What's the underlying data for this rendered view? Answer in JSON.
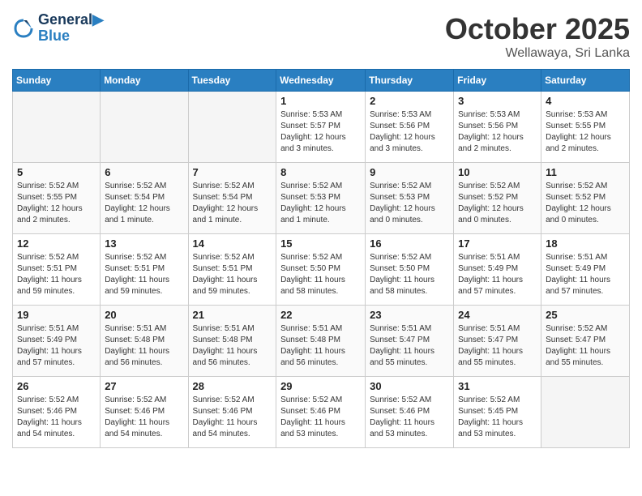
{
  "header": {
    "logo_line1": "General",
    "logo_line2": "Blue",
    "month": "October 2025",
    "location": "Wellawaya, Sri Lanka"
  },
  "weekdays": [
    "Sunday",
    "Monday",
    "Tuesday",
    "Wednesday",
    "Thursday",
    "Friday",
    "Saturday"
  ],
  "weeks": [
    [
      {
        "day": "",
        "info": ""
      },
      {
        "day": "",
        "info": ""
      },
      {
        "day": "",
        "info": ""
      },
      {
        "day": "1",
        "info": "Sunrise: 5:53 AM\nSunset: 5:57 PM\nDaylight: 12 hours and 3 minutes."
      },
      {
        "day": "2",
        "info": "Sunrise: 5:53 AM\nSunset: 5:56 PM\nDaylight: 12 hours and 3 minutes."
      },
      {
        "day": "3",
        "info": "Sunrise: 5:53 AM\nSunset: 5:56 PM\nDaylight: 12 hours and 2 minutes."
      },
      {
        "day": "4",
        "info": "Sunrise: 5:53 AM\nSunset: 5:55 PM\nDaylight: 12 hours and 2 minutes."
      }
    ],
    [
      {
        "day": "5",
        "info": "Sunrise: 5:52 AM\nSunset: 5:55 PM\nDaylight: 12 hours and 2 minutes."
      },
      {
        "day": "6",
        "info": "Sunrise: 5:52 AM\nSunset: 5:54 PM\nDaylight: 12 hours and 1 minute."
      },
      {
        "day": "7",
        "info": "Sunrise: 5:52 AM\nSunset: 5:54 PM\nDaylight: 12 hours and 1 minute."
      },
      {
        "day": "8",
        "info": "Sunrise: 5:52 AM\nSunset: 5:53 PM\nDaylight: 12 hours and 1 minute."
      },
      {
        "day": "9",
        "info": "Sunrise: 5:52 AM\nSunset: 5:53 PM\nDaylight: 12 hours and 0 minutes."
      },
      {
        "day": "10",
        "info": "Sunrise: 5:52 AM\nSunset: 5:52 PM\nDaylight: 12 hours and 0 minutes."
      },
      {
        "day": "11",
        "info": "Sunrise: 5:52 AM\nSunset: 5:52 PM\nDaylight: 12 hours and 0 minutes."
      }
    ],
    [
      {
        "day": "12",
        "info": "Sunrise: 5:52 AM\nSunset: 5:51 PM\nDaylight: 11 hours and 59 minutes."
      },
      {
        "day": "13",
        "info": "Sunrise: 5:52 AM\nSunset: 5:51 PM\nDaylight: 11 hours and 59 minutes."
      },
      {
        "day": "14",
        "info": "Sunrise: 5:52 AM\nSunset: 5:51 PM\nDaylight: 11 hours and 59 minutes."
      },
      {
        "day": "15",
        "info": "Sunrise: 5:52 AM\nSunset: 5:50 PM\nDaylight: 11 hours and 58 minutes."
      },
      {
        "day": "16",
        "info": "Sunrise: 5:52 AM\nSunset: 5:50 PM\nDaylight: 11 hours and 58 minutes."
      },
      {
        "day": "17",
        "info": "Sunrise: 5:51 AM\nSunset: 5:49 PM\nDaylight: 11 hours and 57 minutes."
      },
      {
        "day": "18",
        "info": "Sunrise: 5:51 AM\nSunset: 5:49 PM\nDaylight: 11 hours and 57 minutes."
      }
    ],
    [
      {
        "day": "19",
        "info": "Sunrise: 5:51 AM\nSunset: 5:49 PM\nDaylight: 11 hours and 57 minutes."
      },
      {
        "day": "20",
        "info": "Sunrise: 5:51 AM\nSunset: 5:48 PM\nDaylight: 11 hours and 56 minutes."
      },
      {
        "day": "21",
        "info": "Sunrise: 5:51 AM\nSunset: 5:48 PM\nDaylight: 11 hours and 56 minutes."
      },
      {
        "day": "22",
        "info": "Sunrise: 5:51 AM\nSunset: 5:48 PM\nDaylight: 11 hours and 56 minutes."
      },
      {
        "day": "23",
        "info": "Sunrise: 5:51 AM\nSunset: 5:47 PM\nDaylight: 11 hours and 55 minutes."
      },
      {
        "day": "24",
        "info": "Sunrise: 5:51 AM\nSunset: 5:47 PM\nDaylight: 11 hours and 55 minutes."
      },
      {
        "day": "25",
        "info": "Sunrise: 5:52 AM\nSunset: 5:47 PM\nDaylight: 11 hours and 55 minutes."
      }
    ],
    [
      {
        "day": "26",
        "info": "Sunrise: 5:52 AM\nSunset: 5:46 PM\nDaylight: 11 hours and 54 minutes."
      },
      {
        "day": "27",
        "info": "Sunrise: 5:52 AM\nSunset: 5:46 PM\nDaylight: 11 hours and 54 minutes."
      },
      {
        "day": "28",
        "info": "Sunrise: 5:52 AM\nSunset: 5:46 PM\nDaylight: 11 hours and 54 minutes."
      },
      {
        "day": "29",
        "info": "Sunrise: 5:52 AM\nSunset: 5:46 PM\nDaylight: 11 hours and 53 minutes."
      },
      {
        "day": "30",
        "info": "Sunrise: 5:52 AM\nSunset: 5:46 PM\nDaylight: 11 hours and 53 minutes."
      },
      {
        "day": "31",
        "info": "Sunrise: 5:52 AM\nSunset: 5:45 PM\nDaylight: 11 hours and 53 minutes."
      },
      {
        "day": "",
        "info": ""
      }
    ]
  ]
}
